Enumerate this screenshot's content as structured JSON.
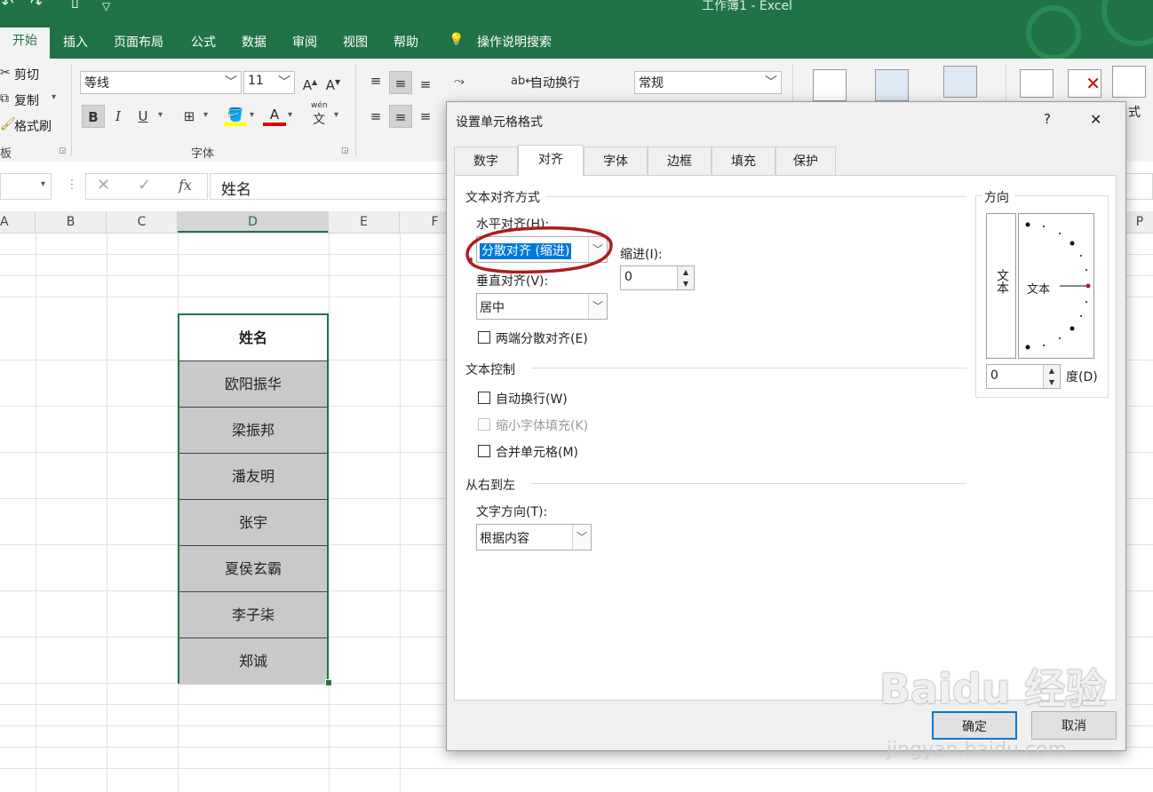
{
  "window": {
    "title": "工作簿1 - Excel"
  },
  "ribbon_tabs": [
    "开始",
    "插入",
    "页面布局",
    "公式",
    "数据",
    "审阅",
    "视图",
    "帮助"
  ],
  "tell_me": "操作说明搜索",
  "clipboard": {
    "cut": "剪切",
    "copy": "复制",
    "format_painter": "格式刷",
    "group": "板"
  },
  "font": {
    "name": "等线",
    "size": "11",
    "group": "字体",
    "grow": "A",
    "shrink": "A",
    "bold": "B",
    "italic": "I",
    "underline": "U",
    "color_a": "A",
    "wen": "wén",
    "wen_char": "文"
  },
  "alignment": {
    "wrap": "自动换行"
  },
  "number": {
    "format": "常规"
  },
  "cells_partial": "式",
  "formula_bar": {
    "value": "姓名",
    "fx": "fx"
  },
  "columns": [
    "A",
    "B",
    "C",
    "D",
    "E",
    "F",
    "P"
  ],
  "names": {
    "header": "姓名",
    "rows": [
      "欧阳振华",
      "梁振邦",
      "潘友明",
      "张宇",
      "夏侯玄霸",
      "李子柒",
      "郑诚"
    ]
  },
  "dialog": {
    "title": "设置单元格格式",
    "help": "?",
    "close": "✕",
    "tabs": [
      "数字",
      "对齐",
      "字体",
      "边框",
      "填充",
      "保护"
    ],
    "text_alignment": "文本对齐方式",
    "horizontal_label": "水平对齐(H):",
    "horizontal_value": "分散对齐 (缩进)",
    "indent_label": "缩进(I):",
    "indent_value": "0",
    "vertical_label": "垂直对齐(V):",
    "vertical_value": "居中",
    "justify_distributed": "两端分散对齐(E)",
    "text_control": "文本控制",
    "wrap_text": "自动换行(W)",
    "shrink_to_fit": "缩小字体填充(K)",
    "merge_cells": "合并单元格(M)",
    "rtl": "从右到左",
    "text_direction_label": "文字方向(T):",
    "text_direction_value": "根据内容",
    "orientation": "方向",
    "vertical_text": "文本",
    "orient_text": "文本",
    "degrees_value": "0",
    "degrees_label": "度(D)",
    "ok": "确定",
    "cancel": "取消"
  },
  "watermark": {
    "main": "Baidu 经验",
    "sub": "jingyan.baidu.com"
  },
  "colors": {
    "excel_green": "#217346",
    "highlight": "#0078d7",
    "annotation_red": "#b01c1c"
  }
}
